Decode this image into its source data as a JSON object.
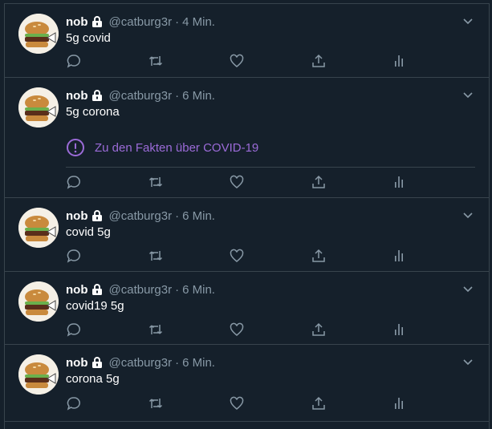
{
  "tweets": [
    {
      "name": "nob",
      "handle": "@catburg3r",
      "sep": "·",
      "time": "4 Min.",
      "text": "5g covid"
    },
    {
      "name": "nob",
      "handle": "@catburg3r",
      "sep": "·",
      "time": "6 Min.",
      "text": "5g corona",
      "covid_label": "Zu den Fakten über COVID-19"
    },
    {
      "name": "nob",
      "handle": "@catburg3r",
      "sep": "·",
      "time": "6 Min.",
      "text": "covid 5g"
    },
    {
      "name": "nob",
      "handle": "@catburg3r",
      "sep": "·",
      "time": "6 Min.",
      "text": "covid19 5g"
    },
    {
      "name": "nob",
      "handle": "@catburg3r",
      "sep": "·",
      "time": "6 Min.",
      "text": "corona 5g"
    }
  ],
  "colors": {
    "background": "#15202b",
    "border": "#38444d",
    "secondary": "#8899a6",
    "covid_accent": "#9b6bd8"
  },
  "icons": [
    "lock-icon",
    "chevron-down-icon",
    "reply-icon",
    "retweet-icon",
    "like-icon",
    "share-icon",
    "analytics-icon",
    "exclamation-circle-icon"
  ]
}
